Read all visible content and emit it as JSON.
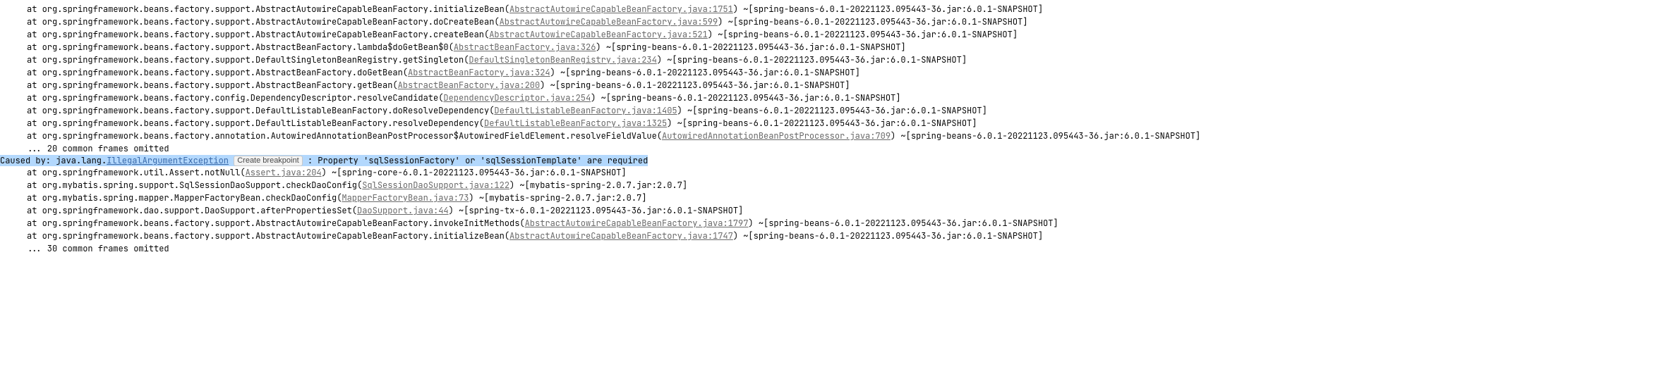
{
  "stack_top": [
    {
      "prefix": "at org.springframework.beans.factory.support.AbstractAutowireCapableBeanFactory.initializeBean(",
      "link": "AbstractAutowireCapableBeanFactory.java:1751",
      "suffix": ") ~[spring-beans-6.0.1-20221123.095443-36.jar:6.0.1-SNAPSHOT]"
    },
    {
      "prefix": "at org.springframework.beans.factory.support.AbstractAutowireCapableBeanFactory.doCreateBean(",
      "link": "AbstractAutowireCapableBeanFactory.java:599",
      "suffix": ") ~[spring-beans-6.0.1-20221123.095443-36.jar:6.0.1-SNAPSHOT]"
    },
    {
      "prefix": "at org.springframework.beans.factory.support.AbstractAutowireCapableBeanFactory.createBean(",
      "link": "AbstractAutowireCapableBeanFactory.java:521",
      "suffix": ") ~[spring-beans-6.0.1-20221123.095443-36.jar:6.0.1-SNAPSHOT]"
    },
    {
      "prefix": "at org.springframework.beans.factory.support.AbstractBeanFactory.lambda$doGetBean$0(",
      "link": "AbstractBeanFactory.java:326",
      "suffix": ") ~[spring-beans-6.0.1-20221123.095443-36.jar:6.0.1-SNAPSHOT]"
    },
    {
      "prefix": "at org.springframework.beans.factory.support.DefaultSingletonBeanRegistry.getSingleton(",
      "link": "DefaultSingletonBeanRegistry.java:234",
      "suffix": ") ~[spring-beans-6.0.1-20221123.095443-36.jar:6.0.1-SNAPSHOT]"
    },
    {
      "prefix": "at org.springframework.beans.factory.support.AbstractBeanFactory.doGetBean(",
      "link": "AbstractBeanFactory.java:324",
      "suffix": ") ~[spring-beans-6.0.1-20221123.095443-36.jar:6.0.1-SNAPSHOT]"
    },
    {
      "prefix": "at org.springframework.beans.factory.support.AbstractBeanFactory.getBean(",
      "link": "AbstractBeanFactory.java:200",
      "suffix": ") ~[spring-beans-6.0.1-20221123.095443-36.jar:6.0.1-SNAPSHOT]"
    },
    {
      "prefix": "at org.springframework.beans.factory.config.DependencyDescriptor.resolveCandidate(",
      "link": "DependencyDescriptor.java:254",
      "suffix": ") ~[spring-beans-6.0.1-20221123.095443-36.jar:6.0.1-SNAPSHOT]"
    },
    {
      "prefix": "at org.springframework.beans.factory.support.DefaultListableBeanFactory.doResolveDependency(",
      "link": "DefaultListableBeanFactory.java:1405",
      "suffix": ") ~[spring-beans-6.0.1-20221123.095443-36.jar:6.0.1-SNAPSHOT]"
    },
    {
      "prefix": "at org.springframework.beans.factory.support.DefaultListableBeanFactory.resolveDependency(",
      "link": "DefaultListableBeanFactory.java:1325",
      "suffix": ") ~[spring-beans-6.0.1-20221123.095443-36.jar:6.0.1-SNAPSHOT]"
    },
    {
      "prefix": "at org.springframework.beans.factory.annotation.AutowiredAnnotationBeanPostProcessor$AutowiredFieldElement.resolveFieldValue(",
      "link": "AutowiredAnnotationBeanPostProcessor.java:709",
      "suffix": ") ~[spring-beans-6.0.1-20221123.095443-36.jar:6.0.1-SNAPSHOT]"
    }
  ],
  "omitted_top": "... 20 common frames omitted",
  "cause": {
    "prefix": "Caused by: java.lang.",
    "exception_link": "IllegalArgumentException",
    "breakpoint_label": "Create breakpoint",
    "message": " : Property 'sqlSessionFactory' or 'sqlSessionTemplate' are required"
  },
  "stack_cause": [
    {
      "prefix": "at org.springframework.util.Assert.notNull(",
      "link": "Assert.java:204",
      "suffix": ") ~[spring-core-6.0.1-20221123.095443-36.jar:6.0.1-SNAPSHOT]"
    },
    {
      "prefix": "at org.mybatis.spring.support.SqlSessionDaoSupport.checkDaoConfig(",
      "link": "SqlSessionDaoSupport.java:122",
      "suffix": ") ~[mybatis-spring-2.0.7.jar:2.0.7]"
    },
    {
      "prefix": "at org.mybatis.spring.mapper.MapperFactoryBean.checkDaoConfig(",
      "link": "MapperFactoryBean.java:73",
      "suffix": ") ~[mybatis-spring-2.0.7.jar:2.0.7]"
    },
    {
      "prefix": "at org.springframework.dao.support.DaoSupport.afterPropertiesSet(",
      "link": "DaoSupport.java:44",
      "suffix": ") ~[spring-tx-6.0.1-20221123.095443-36.jar:6.0.1-SNAPSHOT]"
    },
    {
      "prefix": "at org.springframework.beans.factory.support.AbstractAutowireCapableBeanFactory.invokeInitMethods(",
      "link": "AbstractAutowireCapableBeanFactory.java:1797",
      "suffix": ") ~[spring-beans-6.0.1-20221123.095443-36.jar:6.0.1-SNAPSHOT]"
    },
    {
      "prefix": "at org.springframework.beans.factory.support.AbstractAutowireCapableBeanFactory.initializeBean(",
      "link": "AbstractAutowireCapableBeanFactory.java:1747",
      "suffix": ") ~[spring-beans-6.0.1-20221123.095443-36.jar:6.0.1-SNAPSHOT]"
    }
  ],
  "omitted_bottom": "... 30 common frames omitted"
}
